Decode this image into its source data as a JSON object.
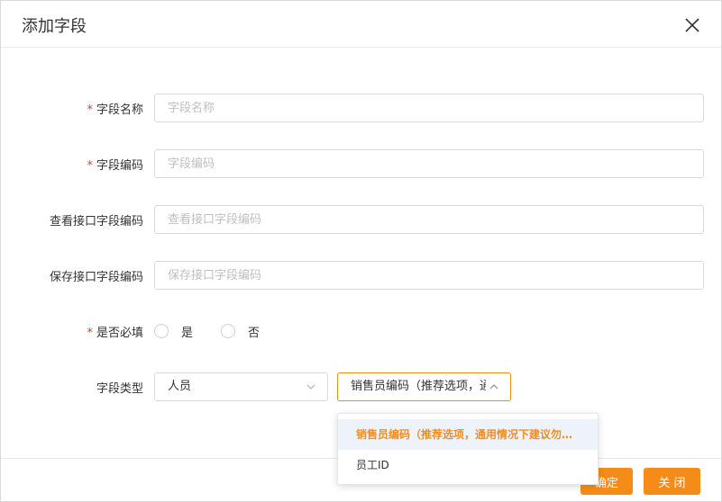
{
  "dialog": {
    "title": "添加字段",
    "close_icon": "close-icon"
  },
  "form": {
    "field_name": {
      "label": "字段名称",
      "required": "*",
      "placeholder": "字段名称",
      "value": ""
    },
    "field_code": {
      "label": "字段编码",
      "required": "*",
      "placeholder": "字段编码",
      "value": ""
    },
    "view_api_code": {
      "label": "查看接口字段编码",
      "placeholder": "查看接口字段编码",
      "value": ""
    },
    "save_api_code": {
      "label": "保存接口字段编码",
      "placeholder": "保存接口字段编码",
      "value": ""
    },
    "is_required": {
      "label": "是否必填",
      "required": "*",
      "options": [
        "是",
        "否"
      ]
    },
    "field_type": {
      "label": "字段类型",
      "type_value": "人员",
      "subtype_value": "销售员编码（推荐选项，通用情况下建议勿…",
      "subtype_options": [
        "销售员编码（推荐选项，通用情况下建议勿…",
        "员工ID"
      ]
    }
  },
  "footer": {
    "confirm_label": "确定",
    "close_label": "关 闭"
  },
  "colors": {
    "accent": "#f58c1a",
    "required": "#e4393c",
    "selected_bg": "#eef3fb"
  }
}
